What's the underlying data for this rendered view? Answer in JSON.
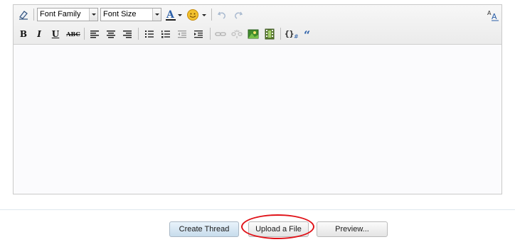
{
  "toolbar": {
    "font_family": "Font Family",
    "font_size": "Font Size",
    "buttons": {
      "eraser": "eraser-icon",
      "text_color": "text-color-icon",
      "smiley": "smiley-icon",
      "undo": "undo-icon",
      "redo": "redo-icon",
      "font_scale": "font-scale-icon",
      "bold": "B",
      "italic": "I",
      "underline": "U",
      "strike": "ABC",
      "align_left": "align-left-icon",
      "align_center": "align-center-icon",
      "align_right": "align-right-icon",
      "bullet_list": "bullet-list-icon",
      "number_list": "numbered-list-icon",
      "outdent": "outdent-icon",
      "indent": "indent-icon",
      "link": "link-icon",
      "unlink": "unlink-icon",
      "image": "image-icon",
      "video": "film-icon",
      "code": "code-icon",
      "quote": "quote-icon"
    }
  },
  "actions": {
    "create": "Create Thread",
    "upload": "Upload a File",
    "preview": "Preview..."
  },
  "colors": {
    "annotation_circle": "#e01218",
    "accent_blue": "#2b5fa8"
  }
}
